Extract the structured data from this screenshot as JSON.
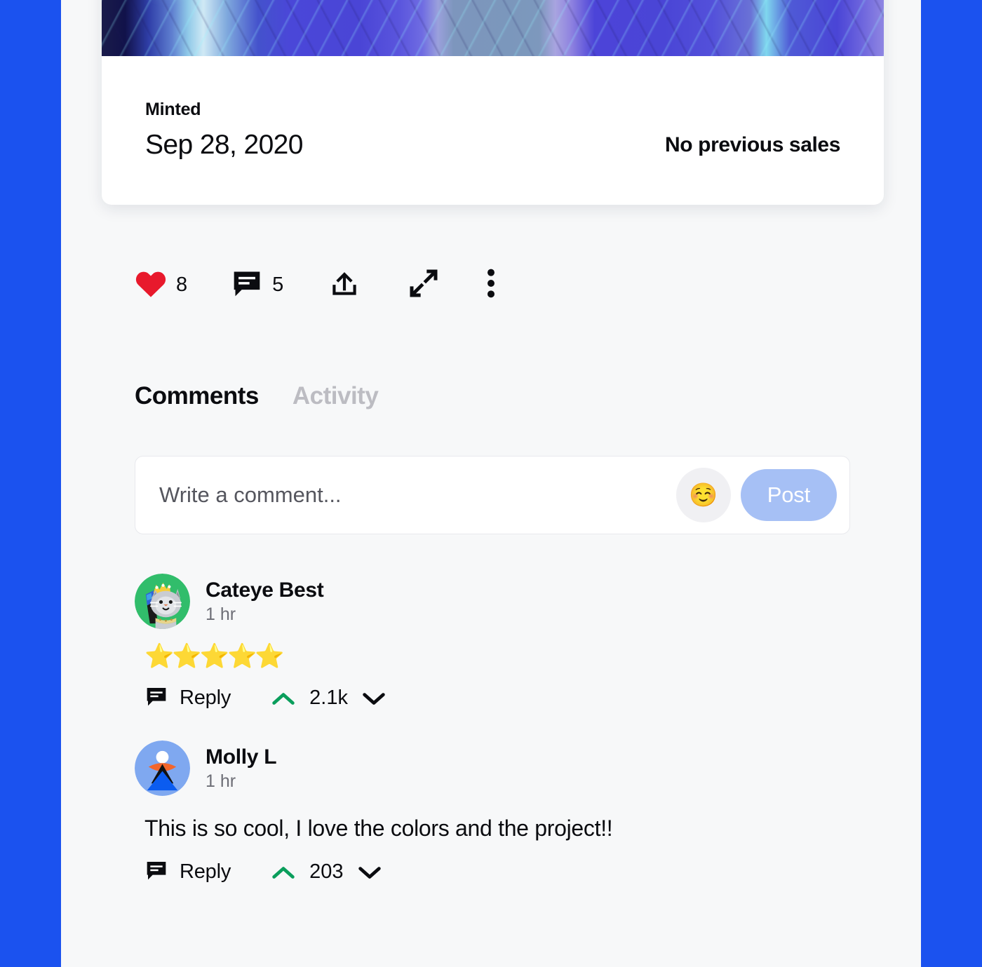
{
  "theme": {
    "frame_blue": "#1b52ef",
    "page_bg": "#f7f8f9",
    "card_bg": "#ffffff",
    "accent_post": "#a6c0f5",
    "upvote_green": "#0a9e5c",
    "heart_red": "#e8192c",
    "text_primary": "#0b0c10",
    "text_muted": "#6d6e76",
    "tab_inactive": "#bcbcc2"
  },
  "nft_card": {
    "artwork_alt": "abstract-blue-lightning-artwork",
    "minted_label": "Minted",
    "minted_date": "Sep 28, 2020",
    "sales_status": "No previous sales"
  },
  "action_bar": {
    "like": {
      "icon": "heart-icon",
      "count": "8"
    },
    "comment": {
      "icon": "comment-icon",
      "count": "5"
    },
    "share": {
      "icon": "share-upload-icon"
    },
    "expand": {
      "icon": "expand-arrows-icon"
    },
    "more": {
      "icon": "more-vertical-icon"
    }
  },
  "tabs": [
    {
      "label": "Comments",
      "active": true
    },
    {
      "label": "Activity",
      "active": false
    }
  ],
  "composer": {
    "placeholder": "Write a comment...",
    "value": "",
    "emoji_glyph": "☺️",
    "emoji_icon": "smiley-face-icon",
    "post_label": "Post"
  },
  "comments": [
    {
      "author": "Cateye Best",
      "time": "1 hr",
      "avatar": "cat-king-avatar",
      "stars": "⭐⭐⭐⭐⭐",
      "body": "",
      "reply_label": "Reply",
      "vote_count": "2.1k"
    },
    {
      "author": "Molly L",
      "time": "1 hr",
      "avatar": "abstract-person-avatar",
      "stars": "",
      "body": "This is so cool, I love the colors and the project!!",
      "reply_label": "Reply",
      "vote_count": "203"
    }
  ]
}
